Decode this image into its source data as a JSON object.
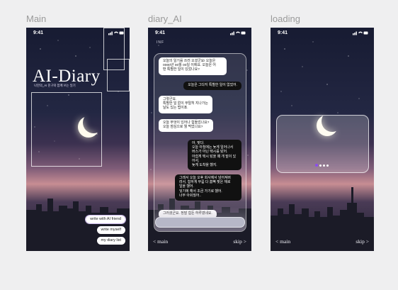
{
  "frames": [
    {
      "label": "Main",
      "time": "9:41",
      "title": "AI-Diary",
      "subtitle": "나만의_AI 친구와 함께 쓰는 일기",
      "buttons": [
        "write with AI friend",
        "write myself",
        "my diary list"
      ]
    },
    {
      "label": "diary_AI",
      "time": "9:41",
      "top_label": "INF",
      "messages": [
        {
          "role": "ai",
          "text": "오늘의 일기를 쓰러 오셨군요! 오늘은\n0000년 00월 00일 이에요. 오늘은 어\n떤 특별한 일이 있었나요?"
        },
        {
          "role": "me",
          "text": "오늘은 그다지 특별한 일이 없었어."
        },
        {
          "role": "ai",
          "text": "그렇군요.\n특별한 일 없이 무탈히 지나가는\n날도 있는 법이죠."
        },
        {
          "role": "ai",
          "text": "오늘 무엇이 있어나 힘들었나요?\n오늘 점심으로 뭘 먹었나요?"
        },
        {
          "role": "me",
          "text": "아, 맞다.\n오늘 아침에는 늦게 일어나서\n버스가 아닌 택시를 탔어.\n아쉽게 택시 탔을 때 개 밑이 있어서,\n늦게 도착을 했지."
        },
        {
          "role": "me",
          "text": "그래서 오늘 오후 회사에서 넘어져버\n려서, 험하게 무릎 다 흠뻑 젖은 채로\n일을 했어.\n잊기에 해서 조금 가기로 했어.\n너무 아쉬웠어.."
        },
        {
          "role": "ai",
          "text": "그러셨군요. 정말 힘든 하루였네요."
        }
      ],
      "nav_back": "< main",
      "nav_skip": "skip >"
    },
    {
      "label": "loading",
      "time": "9:41",
      "loading_dots": 4,
      "nav_back": "< main",
      "nav_skip": "skip >"
    }
  ],
  "colors": {
    "sky_top": "#171b32",
    "sky_glow": "#c78d93",
    "accent_dot": "#8a4cf0",
    "ai_bubble": "#ffffff",
    "user_bubble": "#111111"
  }
}
